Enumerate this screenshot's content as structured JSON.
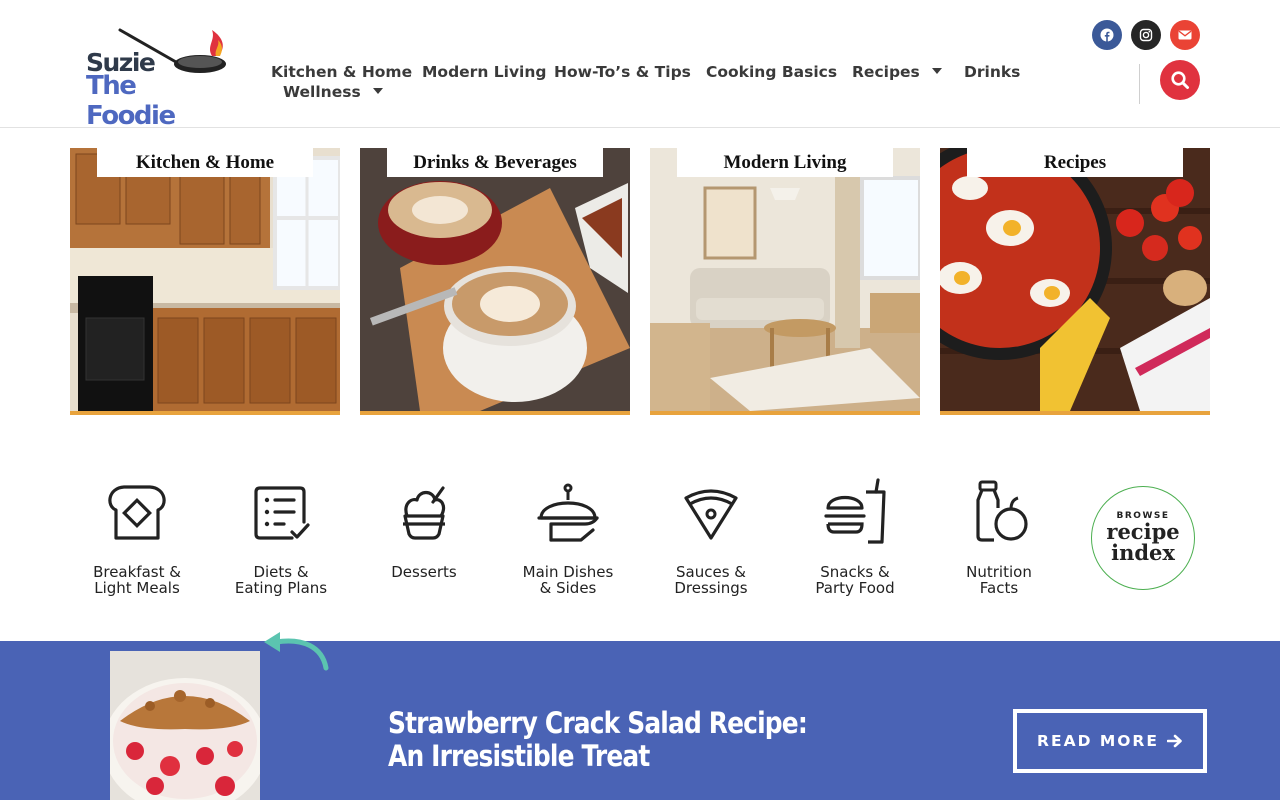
{
  "site": {
    "logo_line1": "Suzie",
    "logo_line2": "The Foodie"
  },
  "nav": {
    "items": [
      {
        "label": "Kitchen & Home",
        "has_dropdown": false
      },
      {
        "label": "Modern Living",
        "has_dropdown": false
      },
      {
        "label": "How-To’s & Tips",
        "has_dropdown": false
      },
      {
        "label": "Cooking Basics",
        "has_dropdown": false
      },
      {
        "label": "Recipes",
        "has_dropdown": true
      },
      {
        "label": "Drinks",
        "has_dropdown": false
      },
      {
        "label": "Wellness",
        "has_dropdown": true
      }
    ]
  },
  "social": [
    {
      "icon": "facebook-icon",
      "color": "#3b5998"
    },
    {
      "icon": "instagram-icon",
      "color": "#262626"
    },
    {
      "icon": "envelope-icon",
      "color": "#ea4335"
    }
  ],
  "search": {
    "icon": "search-icon",
    "color": "#e0323f"
  },
  "tiles": [
    {
      "label": "Kitchen & Home"
    },
    {
      "label": "Drinks & Beverages"
    },
    {
      "label": "Modern Living"
    },
    {
      "label": "Recipes"
    }
  ],
  "categories": [
    {
      "label": "Breakfast &\nLight Meals",
      "icon": "toast-icon"
    },
    {
      "label": "Diets &\nEating Plans",
      "icon": "checklist-icon"
    },
    {
      "label": "Desserts",
      "icon": "sundae-icon"
    },
    {
      "label": "Main Dishes\n& Sides",
      "icon": "serving-dish-icon"
    },
    {
      "label": "Sauces &\nDressings",
      "icon": "pizza-slice-icon"
    },
    {
      "label": "Snacks &\nParty Food",
      "icon": "burger-drink-icon"
    },
    {
      "label": "Nutrition\nFacts",
      "icon": "bottle-apple-icon"
    }
  ],
  "browse": {
    "line1": "BROWSE",
    "line2": "recipe",
    "line3": "index"
  },
  "featured": {
    "title": "Strawberry Crack Salad Recipe: An Irresistible Treat",
    "button": "READ MORE"
  },
  "colors": {
    "accent_red": "#e0323f",
    "tile_border": "#e8a33d",
    "banner_blue": "#4a63b5",
    "browse_ring": "#4caf50"
  }
}
